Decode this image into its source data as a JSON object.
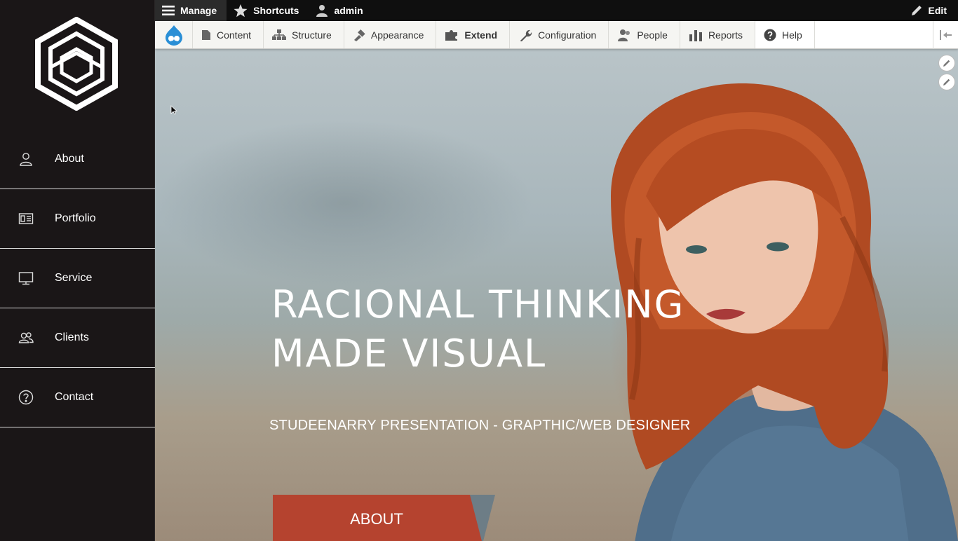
{
  "sidebar": {
    "items": [
      {
        "label": "About",
        "icon": "user-icon"
      },
      {
        "label": "Portfolio",
        "icon": "portfolio-icon"
      },
      {
        "label": "Service",
        "icon": "monitor-icon"
      },
      {
        "label": "Clients",
        "icon": "users-icon"
      },
      {
        "label": "Contact",
        "icon": "help-circle-icon"
      }
    ]
  },
  "adminbar": {
    "manage": "Manage",
    "shortcuts": "Shortcuts",
    "user": "admin",
    "edit": "Edit"
  },
  "tray": {
    "items": [
      "Content",
      "Structure",
      "Appearance",
      "Extend",
      "Configuration",
      "People",
      "Reports",
      "Help"
    ]
  },
  "hero": {
    "headline_line1": "Racional Thinking",
    "headline_line2": "Made Visual",
    "subline": "STUDEENARRY PRESENTATION - GRAPTHIC/WEB DESIGNER",
    "button": "ABOUT"
  },
  "colors": {
    "sidebar_bg": "#1a1617",
    "accent": "#b5432f",
    "accent_dark": "#6d7d86",
    "drupal_blue": "#2a8fd6"
  }
}
